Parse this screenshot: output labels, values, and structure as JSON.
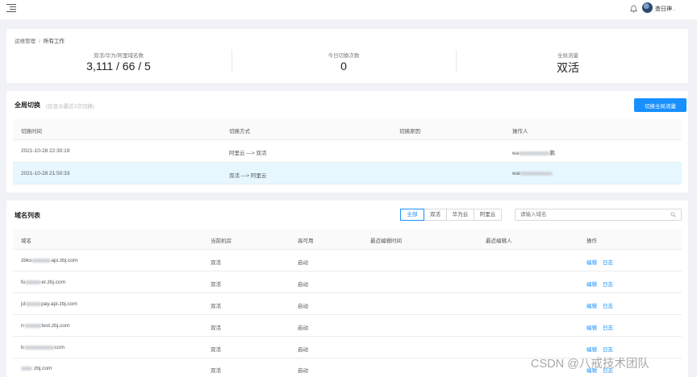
{
  "header": {
    "user_name": "查日神 ."
  },
  "breadcrumb": {
    "parent": "运维管理",
    "current": "所有工作"
  },
  "stats": [
    {
      "label": "双活/华为/阿里域名数",
      "value": "3,111 / 66 / 5"
    },
    {
      "label": "今日切换次数",
      "value": "0"
    },
    {
      "label": "全局流量",
      "value": "双活"
    }
  ],
  "switch_section": {
    "title": "全局切换",
    "hint": "(仅显示最近2次切换)",
    "button": "切换全局流量",
    "columns": [
      "切换时间",
      "切换方式",
      "切换原因",
      "操作人"
    ],
    "rows": [
      {
        "time": "2021-10-28 22:30:19",
        "method": "阿里云 —> 双活",
        "reason": "",
        "operator_prefix": "wa",
        "operator_suffix": "鹏"
      },
      {
        "time": "2021-10-28 21:50:33",
        "method": "双活 —> 阿里云",
        "reason": "",
        "operator_prefix": "war",
        "operator_suffix": ""
      }
    ]
  },
  "domain_section": {
    "title": "域名列表",
    "filters": [
      "全部",
      "双活",
      "华为云",
      "阿里云"
    ],
    "search_placeholder": "请输入域名",
    "columns": [
      "域名",
      "当前机房",
      "高可用",
      "最近编辑时间",
      "最近编辑人",
      "操作"
    ],
    "edit_label": "编辑",
    "log_label": "日志",
    "rows": [
      {
        "domain_prefix": "zbks",
        "domain_suffix": "api.zbj.com",
        "room": "双活",
        "ha": "启动",
        "edit_time": "",
        "editor": ""
      },
      {
        "domain_prefix": "fu",
        "domain_suffix": "er.zbj.com",
        "room": "双活",
        "ha": "启动",
        "edit_time": "",
        "editor": ""
      },
      {
        "domain_prefix": "jd",
        "domain_suffix": "pay.api.zbj.com",
        "room": "双活",
        "ha": "启动",
        "edit_time": "",
        "editor": ""
      },
      {
        "domain_prefix": "n",
        "domain_suffix": "test.zbj.com",
        "room": "双活",
        "ha": "启动",
        "edit_time": "",
        "editor": ""
      },
      {
        "domain_prefix": "b",
        "domain_suffix": "com",
        "room": "双活",
        "ha": "启动",
        "edit_time": "",
        "editor": ""
      },
      {
        "domain_prefix": "",
        "domain_suffix": "zbj.com",
        "room": "双活",
        "ha": "启动",
        "edit_time": "",
        "editor": ""
      }
    ]
  },
  "watermark": "CSDN @八戒技术团队"
}
